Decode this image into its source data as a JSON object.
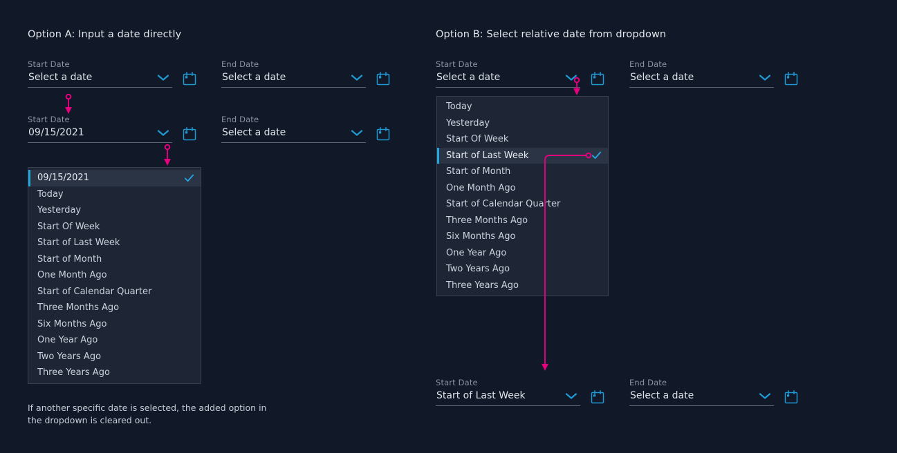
{
  "theme": {
    "background": "#111827",
    "panel_bg": "#1e2535",
    "panel_border": "#39414f",
    "accent_cyan": "#24a6e0",
    "accent_pink": "#e5007e",
    "label_grey": "#8a93a3",
    "value_text": "#dfe4ea",
    "underline": "#5c6573",
    "selected_row_bg": "#2b3445"
  },
  "option_a": {
    "title": "Option A: Input a date directly",
    "row1": {
      "start": {
        "label": "Start Date",
        "value": "Select a date",
        "placeholder": "Select a date",
        "calendar_icon": "calendar-icon",
        "chevron_icon": "chevron-down-icon"
      },
      "end": {
        "label": "End Date",
        "value": "Select a date",
        "placeholder": "Select a date",
        "calendar_icon": "calendar-icon",
        "chevron_icon": "chevron-down-icon"
      }
    },
    "row2": {
      "start": {
        "label": "Start Date",
        "value": "09/15/2021",
        "placeholder": "Select a date",
        "calendar_icon": "calendar-icon",
        "chevron_icon": "chevron-down-icon"
      },
      "end": {
        "label": "End Date",
        "value": "Select a date",
        "placeholder": "Select a date",
        "calendar_icon": "calendar-icon",
        "chevron_icon": "chevron-down-icon"
      }
    },
    "dropdown": {
      "selected_index": 0,
      "check_icon": "check-icon",
      "items": [
        "09/15/2021",
        "Today",
        "Yesterday",
        "Start Of Week",
        "Start of Last Week",
        "Start of Month",
        "One Month Ago",
        "Start of Calendar Quarter",
        "Three Months Ago",
        "Six Months Ago",
        "One Year Ago",
        "Two Years Ago",
        "Three Years Ago"
      ]
    },
    "caption": "If another specific date is selected, the added option in the dropdown is cleared out."
  },
  "option_b": {
    "title": "Option B: Select relative date from dropdown",
    "row1": {
      "start": {
        "label": "Start Date",
        "value": "Select a date",
        "placeholder": "Select a date",
        "calendar_icon": "calendar-icon",
        "chevron_icon": "chevron-down-icon"
      },
      "end": {
        "label": "End Date",
        "value": "Select a date",
        "placeholder": "Select a date",
        "calendar_icon": "calendar-icon",
        "chevron_icon": "chevron-down-icon"
      }
    },
    "row2": {
      "start": {
        "label": "Start Date",
        "value": "Start of Last Week",
        "placeholder": "Select a date",
        "calendar_icon": "calendar-icon",
        "chevron_icon": "chevron-down-icon"
      },
      "end": {
        "label": "End Date",
        "value": "Select a date",
        "placeholder": "Select a date",
        "calendar_icon": "calendar-icon",
        "chevron_icon": "chevron-down-icon"
      }
    },
    "dropdown": {
      "selected_index": 3,
      "check_icon": "check-icon",
      "items": [
        "Today",
        "Yesterday",
        "Start Of Week",
        "Start of Last Week",
        "Start of Month",
        "One Month Ago",
        "Start of Calendar Quarter",
        "Three Months Ago",
        "Six Months Ago",
        "One Year Ago",
        "Two Years Ago",
        "Three Years Ago"
      ]
    }
  },
  "annotations": {
    "arrow_a1": "flow-arrow-field-to-field",
    "arrow_a2": "flow-arrow-field-to-dropdown",
    "arrow_b1": "flow-arrow-field-to-dropdown",
    "arrow_b2": "flow-arrow-selection-to-field"
  }
}
